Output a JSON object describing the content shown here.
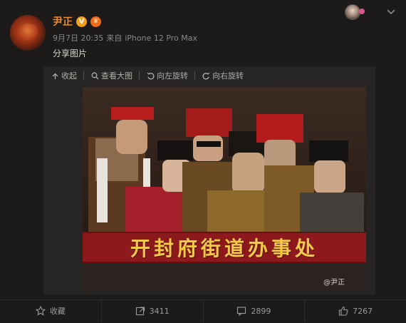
{
  "post": {
    "username": "尹正",
    "verified_badge": "V",
    "member_badge": "♛",
    "date": "9月7日 20:35",
    "source_prefix": "来自",
    "device": "iPhone 12 Pro Max",
    "text": "分享图片"
  },
  "image_toolbar": {
    "collapse": "收起",
    "view_large": "查看大图",
    "rotate_left": "向左旋转",
    "rotate_right": "向右旋转"
  },
  "image": {
    "banner_text": "开封府街道办事处",
    "watermark": "@尹正"
  },
  "footer": {
    "favorite": "收藏",
    "repost_count": "3411",
    "comment_count": "2899",
    "like_count": "7267"
  },
  "colors": {
    "username": "#eb8a32",
    "banner_bg": "#8c1a1d",
    "banner_text": "#f3c94a"
  }
}
